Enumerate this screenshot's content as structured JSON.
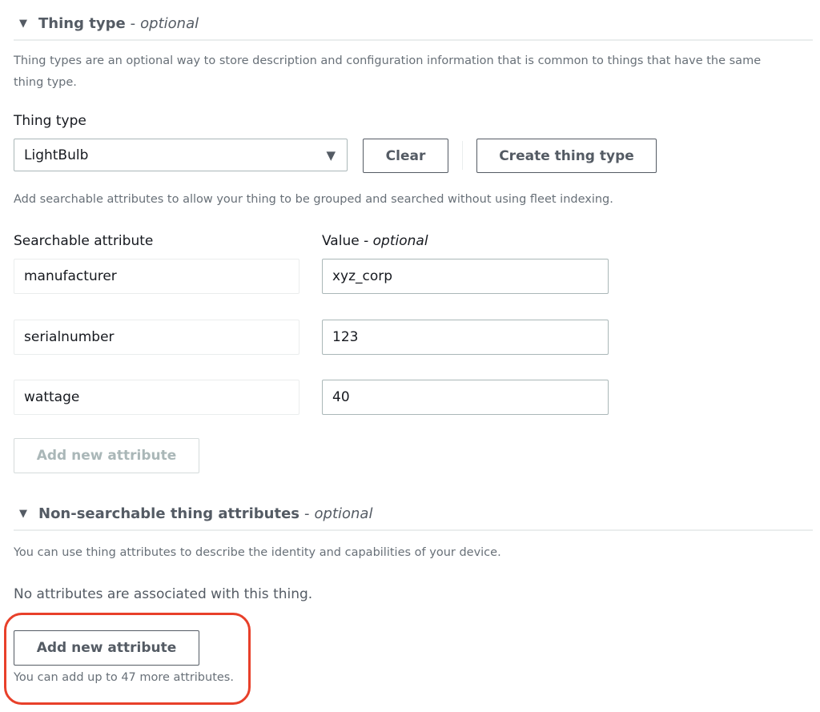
{
  "thing_type_section": {
    "caret_icon": "▼",
    "title": "Thing type",
    "separator": "-",
    "optional": "optional",
    "description_line1": "Thing types are an optional way to store description and configuration information that is common to things that have the same",
    "description_line2": "thing type.",
    "field_label": "Thing type",
    "selected_value": "LightBulb",
    "dropdown_icon": "▼",
    "clear_button": "Clear",
    "create_button": "Create thing type",
    "searchable_help": "Add searchable attributes to allow your thing to be grouped and searched without using fleet indexing.",
    "attribute_column_label": "Searchable attribute",
    "value_column_label": "Value",
    "value_optional": "optional",
    "attributes": [
      {
        "name": "manufacturer",
        "value": "xyz_corp"
      },
      {
        "name": "serialnumber",
        "value": "123"
      },
      {
        "name": "wattage",
        "value": "40"
      }
    ],
    "add_attribute_button": "Add new attribute"
  },
  "non_searchable_section": {
    "caret_icon": "▼",
    "title": "Non-searchable thing attributes",
    "separator": "-",
    "optional": "optional",
    "description": "You can use thing attributes to describe the identity and capabilities of your device.",
    "empty_message": "No attributes are associated with this thing.",
    "add_attribute_button": "Add new attribute",
    "limit_text": "You can add up to 47 more attributes."
  },
  "colors": {
    "highlight": "#e8402a",
    "button_text": "#545b64",
    "disabled_text": "#aab7b8"
  }
}
